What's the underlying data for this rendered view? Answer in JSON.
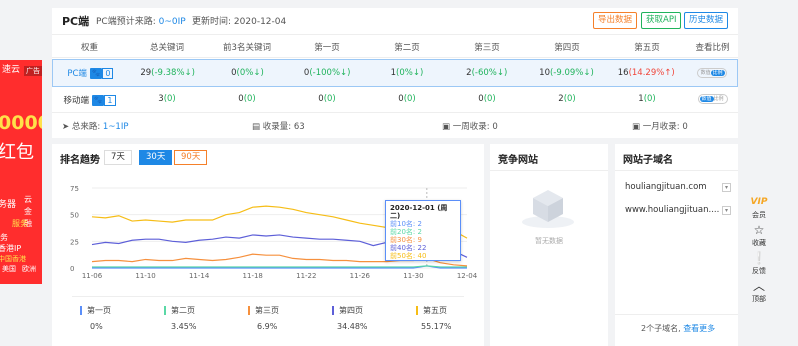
{
  "ad": {
    "tag": "广告",
    "lines": [
      "速云",
      "0000",
      "红包",
      "务器",
      "云",
      "金",
      "融",
      "服务",
      "务",
      "香港IP",
      "中国香港",
      "美国",
      "欧洲"
    ]
  },
  "header": {
    "title": "PC端",
    "source_label": "PC端预计来路:",
    "source_value": "0~0IP",
    "update_label": "更新时间:",
    "update_value": "2020-12-04",
    "btn_export": "导出数据",
    "btn_api": "获取API",
    "btn_history": "历史数据"
  },
  "table": {
    "headers": [
      "权重",
      "总关键词",
      "前3名关键词",
      "第一页",
      "第二页",
      "第三页",
      "第四页",
      "第五页",
      "查看比例"
    ],
    "rows": [
      {
        "device": "PC端",
        "weight": "0",
        "total": "29",
        "total_chg": "(-9.38%↓)",
        "top3": "0",
        "top3_chg": "(0%↓)",
        "p1": "0",
        "p1_chg": "(-100%↓)",
        "p2": "1",
        "p2_chg": "(0%↓)",
        "p3": "2",
        "p3_chg": "(-60%↓)",
        "p4": "10",
        "p4_chg": "(-9.09%↓)",
        "p5": "16",
        "p5_chg": "(14.29%↑)",
        "tg_a": "数值",
        "tg_b": "比例"
      },
      {
        "device": "移动端",
        "weight": "1",
        "total": "3",
        "total_chg": "(0)",
        "top3": "0",
        "top3_chg": "(0)",
        "p1": "0",
        "p1_chg": "(0)",
        "p2": "0",
        "p2_chg": "(0)",
        "p3": "0",
        "p3_chg": "(0)",
        "p4": "2",
        "p4_chg": "(0)",
        "p5": "1",
        "p5_chg": "(0)",
        "tg_a": "数值",
        "tg_b": "比例"
      }
    ]
  },
  "stats": {
    "source": "总来路:",
    "source_val": "1~1IP",
    "indexed": "收录量:",
    "indexed_val": "63",
    "week": "一周收录:",
    "week_val": "0",
    "month": "一月收录:",
    "month_val": "0"
  },
  "trend": {
    "title": "排名趋势",
    "r7": "7天",
    "r30": "30天",
    "r90": "90天",
    "tooltip": {
      "date": "2020-12-01 (周二)",
      "lines": [
        "前10名: 2",
        "前20名: 2",
        "前30名: 9",
        "前40名: 22",
        "前50名: 40"
      ]
    }
  },
  "chart_data": {
    "type": "line",
    "x": [
      "11-06",
      "11-07",
      "11-08",
      "11-09",
      "11-10",
      "11-11",
      "11-12",
      "11-13",
      "11-14",
      "11-15",
      "11-16",
      "11-17",
      "11-18",
      "11-19",
      "11-20",
      "11-21",
      "11-22",
      "11-23",
      "11-24",
      "11-25",
      "11-26",
      "11-27",
      "11-28",
      "11-29",
      "11-30",
      "12-01",
      "12-02",
      "12-03",
      "12-04"
    ],
    "xticks": [
      "11-06",
      "11-10",
      "11-14",
      "11-18",
      "11-22",
      "11-26",
      "11-30",
      "12-04"
    ],
    "yticks": [
      "0",
      "25",
      "50",
      "75"
    ],
    "ylim": [
      0,
      75
    ],
    "series": [
      {
        "name": "第一页",
        "color": "#5b8ff9",
        "values": [
          0,
          0,
          0,
          0,
          0,
          0,
          0,
          0,
          0,
          0,
          0,
          0,
          0,
          0,
          0,
          0,
          0,
          0,
          0,
          0,
          0,
          0,
          0,
          0,
          0,
          2,
          0,
          0,
          0
        ]
      },
      {
        "name": "第二页",
        "color": "#5ad8a6",
        "values": [
          1,
          1,
          1,
          1,
          1,
          1,
          1,
          1,
          1,
          1,
          1,
          1,
          1,
          1,
          1,
          1,
          1,
          1,
          1,
          1,
          1,
          1,
          1,
          1,
          1,
          2,
          1,
          1,
          1
        ]
      },
      {
        "name": "第三页",
        "color": "#f6903d",
        "values": [
          6,
          7,
          7,
          6,
          8,
          7,
          7,
          9,
          8,
          7,
          8,
          10,
          13,
          12,
          12,
          9,
          8,
          8,
          7,
          7,
          6,
          6,
          6,
          7,
          7,
          9,
          5,
          3,
          2
        ]
      },
      {
        "name": "第四页",
        "color": "#5d5fd8",
        "values": [
          22,
          24,
          23,
          26,
          27,
          27,
          25,
          24,
          26,
          27,
          29,
          28,
          31,
          30,
          31,
          29,
          28,
          27,
          27,
          26,
          25,
          21,
          24,
          22,
          22,
          22,
          20,
          16,
          10
        ]
      },
      {
        "name": "第五页",
        "color": "#f6bd16",
        "values": [
          48,
          47,
          49,
          44,
          45,
          44,
          43,
          45,
          45,
          45,
          50,
          52,
          57,
          58,
          57,
          55,
          52,
          50,
          48,
          45,
          42,
          40,
          38,
          38,
          39,
          40,
          38,
          35,
          28
        ]
      }
    ],
    "legend": [
      {
        "name": "第一页",
        "pct": "0%"
      },
      {
        "name": "第二页",
        "pct": "3.45%"
      },
      {
        "name": "第三页",
        "pct": "6.9%"
      },
      {
        "name": "第四页",
        "pct": "34.48%"
      },
      {
        "name": "第五页",
        "pct": "55.17%"
      }
    ]
  },
  "competition": {
    "title": "竞争网站",
    "empty": "暂无数据"
  },
  "subdomains": {
    "title": "网站子域名",
    "items": [
      "houliangjituan.com",
      "www.houliangjituan...."
    ],
    "count": "2个子域名,",
    "more": "查看更多"
  },
  "sidebar": {
    "vip": "会员",
    "fav": "收藏",
    "feedback": "反馈",
    "top": "顶部"
  },
  "colors": {
    "accent": "#1e88e5",
    "orange": "#f5802a",
    "green": "#20b35c",
    "red": "#f0453a"
  }
}
